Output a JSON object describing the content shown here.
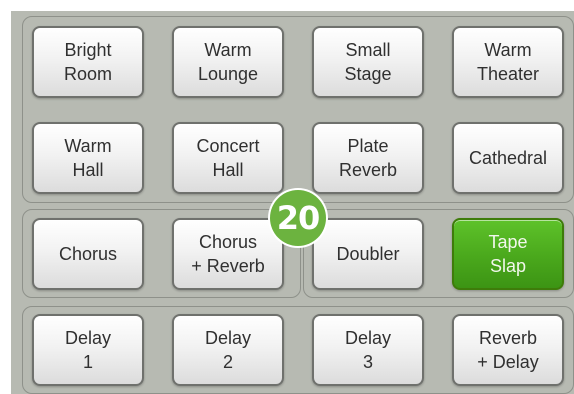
{
  "presets": {
    "row1": [
      {
        "label": "Bright\nRoom"
      },
      {
        "label": "Warm\nLounge"
      },
      {
        "label": "Small\nStage"
      },
      {
        "label": "Warm\nTheater"
      }
    ],
    "row2": [
      {
        "label": "Warm\nHall"
      },
      {
        "label": "Concert\nHall"
      },
      {
        "label": "Plate\nReverb"
      },
      {
        "label": "Cathedral"
      }
    ],
    "row3": [
      {
        "label": "Chorus"
      },
      {
        "label": "Chorus\n+ Reverb"
      },
      {
        "label": "Doubler"
      },
      {
        "label": "Tape\nSlap",
        "selected": true
      }
    ],
    "row4": [
      {
        "label": "Delay\n1"
      },
      {
        "label": "Delay\n2"
      },
      {
        "label": "Delay\n3"
      },
      {
        "label": "Reverb\n+ Delay"
      }
    ]
  },
  "badge": {
    "text": "20"
  },
  "colors": {
    "panel_bg": "#b7bab2",
    "selected_button": "#4aa81c",
    "badge": "#6cb33f"
  }
}
